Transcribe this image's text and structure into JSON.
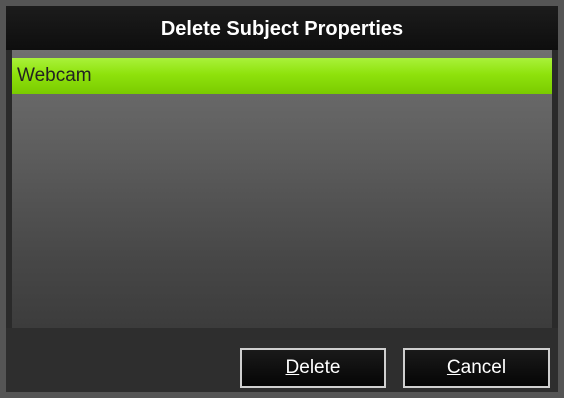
{
  "dialog": {
    "title": "Delete Subject Properties"
  },
  "list": {
    "items": [
      {
        "label": "Webcam",
        "selected": true
      }
    ]
  },
  "buttons": {
    "delete": {
      "accel": "D",
      "rest": "elete"
    },
    "cancel": {
      "accel": "C",
      "rest": "ancel"
    }
  },
  "colors": {
    "selection": "#8fe20c",
    "title_bar": "#111111",
    "frame": "#555555"
  }
}
